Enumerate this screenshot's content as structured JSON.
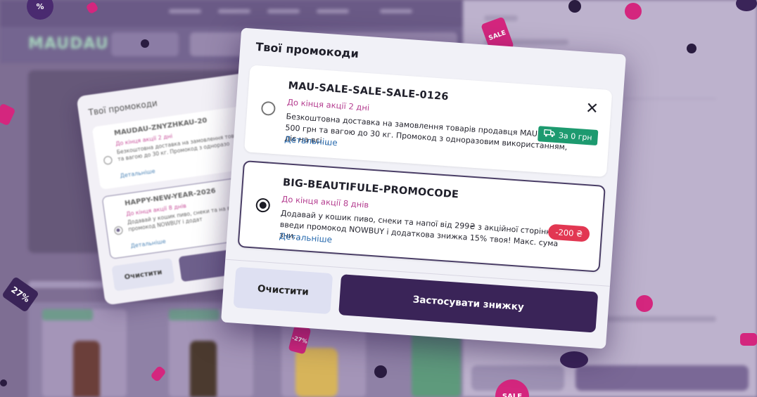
{
  "modal": {
    "title": "Твої промокоди",
    "close_symbol": "✕",
    "promos": [
      {
        "code": "MAU-SALE-SALE-SALE-0126",
        "until": "До кінця акції 2 дні",
        "description": "Безкоштовна доставка на замовлення товарів продавця MAUDAU від 500 грн та вагою до 30 кг. Промокод з одноразовим використанням, діє на всі...",
        "more": "Детальніше",
        "badge": "За 0 грн",
        "badge_icon": "truck-icon",
        "selected": false
      },
      {
        "code": "BIG-BEAUTIFULE-PROMOCODE",
        "until": "До кінця акції 8 днів",
        "description": "Додавай у кошик пиво, снеки та напої від 299₴ з акційної сторінки та введи промокод NOWBUY і додаткова знижка 15% твоя! Макс. сума зни...",
        "more": "Детальніше",
        "badge": "-200 ₴",
        "selected": true
      }
    ],
    "clear_label": "Очистити",
    "apply_label": "Застосувати знижку"
  },
  "back_modal": {
    "title": "Твої промокоди",
    "promos": [
      {
        "code": "MAUDAU-ZNYZHKAU-20",
        "until": "До кінця акції 2 дні",
        "description": "Безкоштовна доставка на замовлення това грн та вагою до 30 кг. Промокод з одноразо",
        "more": "Детальніше",
        "selected": false
      },
      {
        "code": "HAPPY-NEW-YEAR-2026",
        "until": "До кінця акції 8 днів",
        "description": "Додавай у кошик пиво, снеки та на введи промокод NOWBUY і додат",
        "more": "Детальніше",
        "selected": true
      }
    ],
    "clear_label": "Очистити"
  },
  "background": {
    "logo": "MAUDAU"
  },
  "confetti": {
    "tags": [
      "SALE",
      "27%",
      "-27%",
      "SALE",
      "%"
    ]
  },
  "colors": {
    "accent_dark": "#3a2458",
    "promo_pink": "#b43c8f",
    "link_blue": "#2c6db0",
    "badge_green": "#1d9a6f",
    "badge_red": "#e23752",
    "tag_magenta": "#d4267e"
  }
}
